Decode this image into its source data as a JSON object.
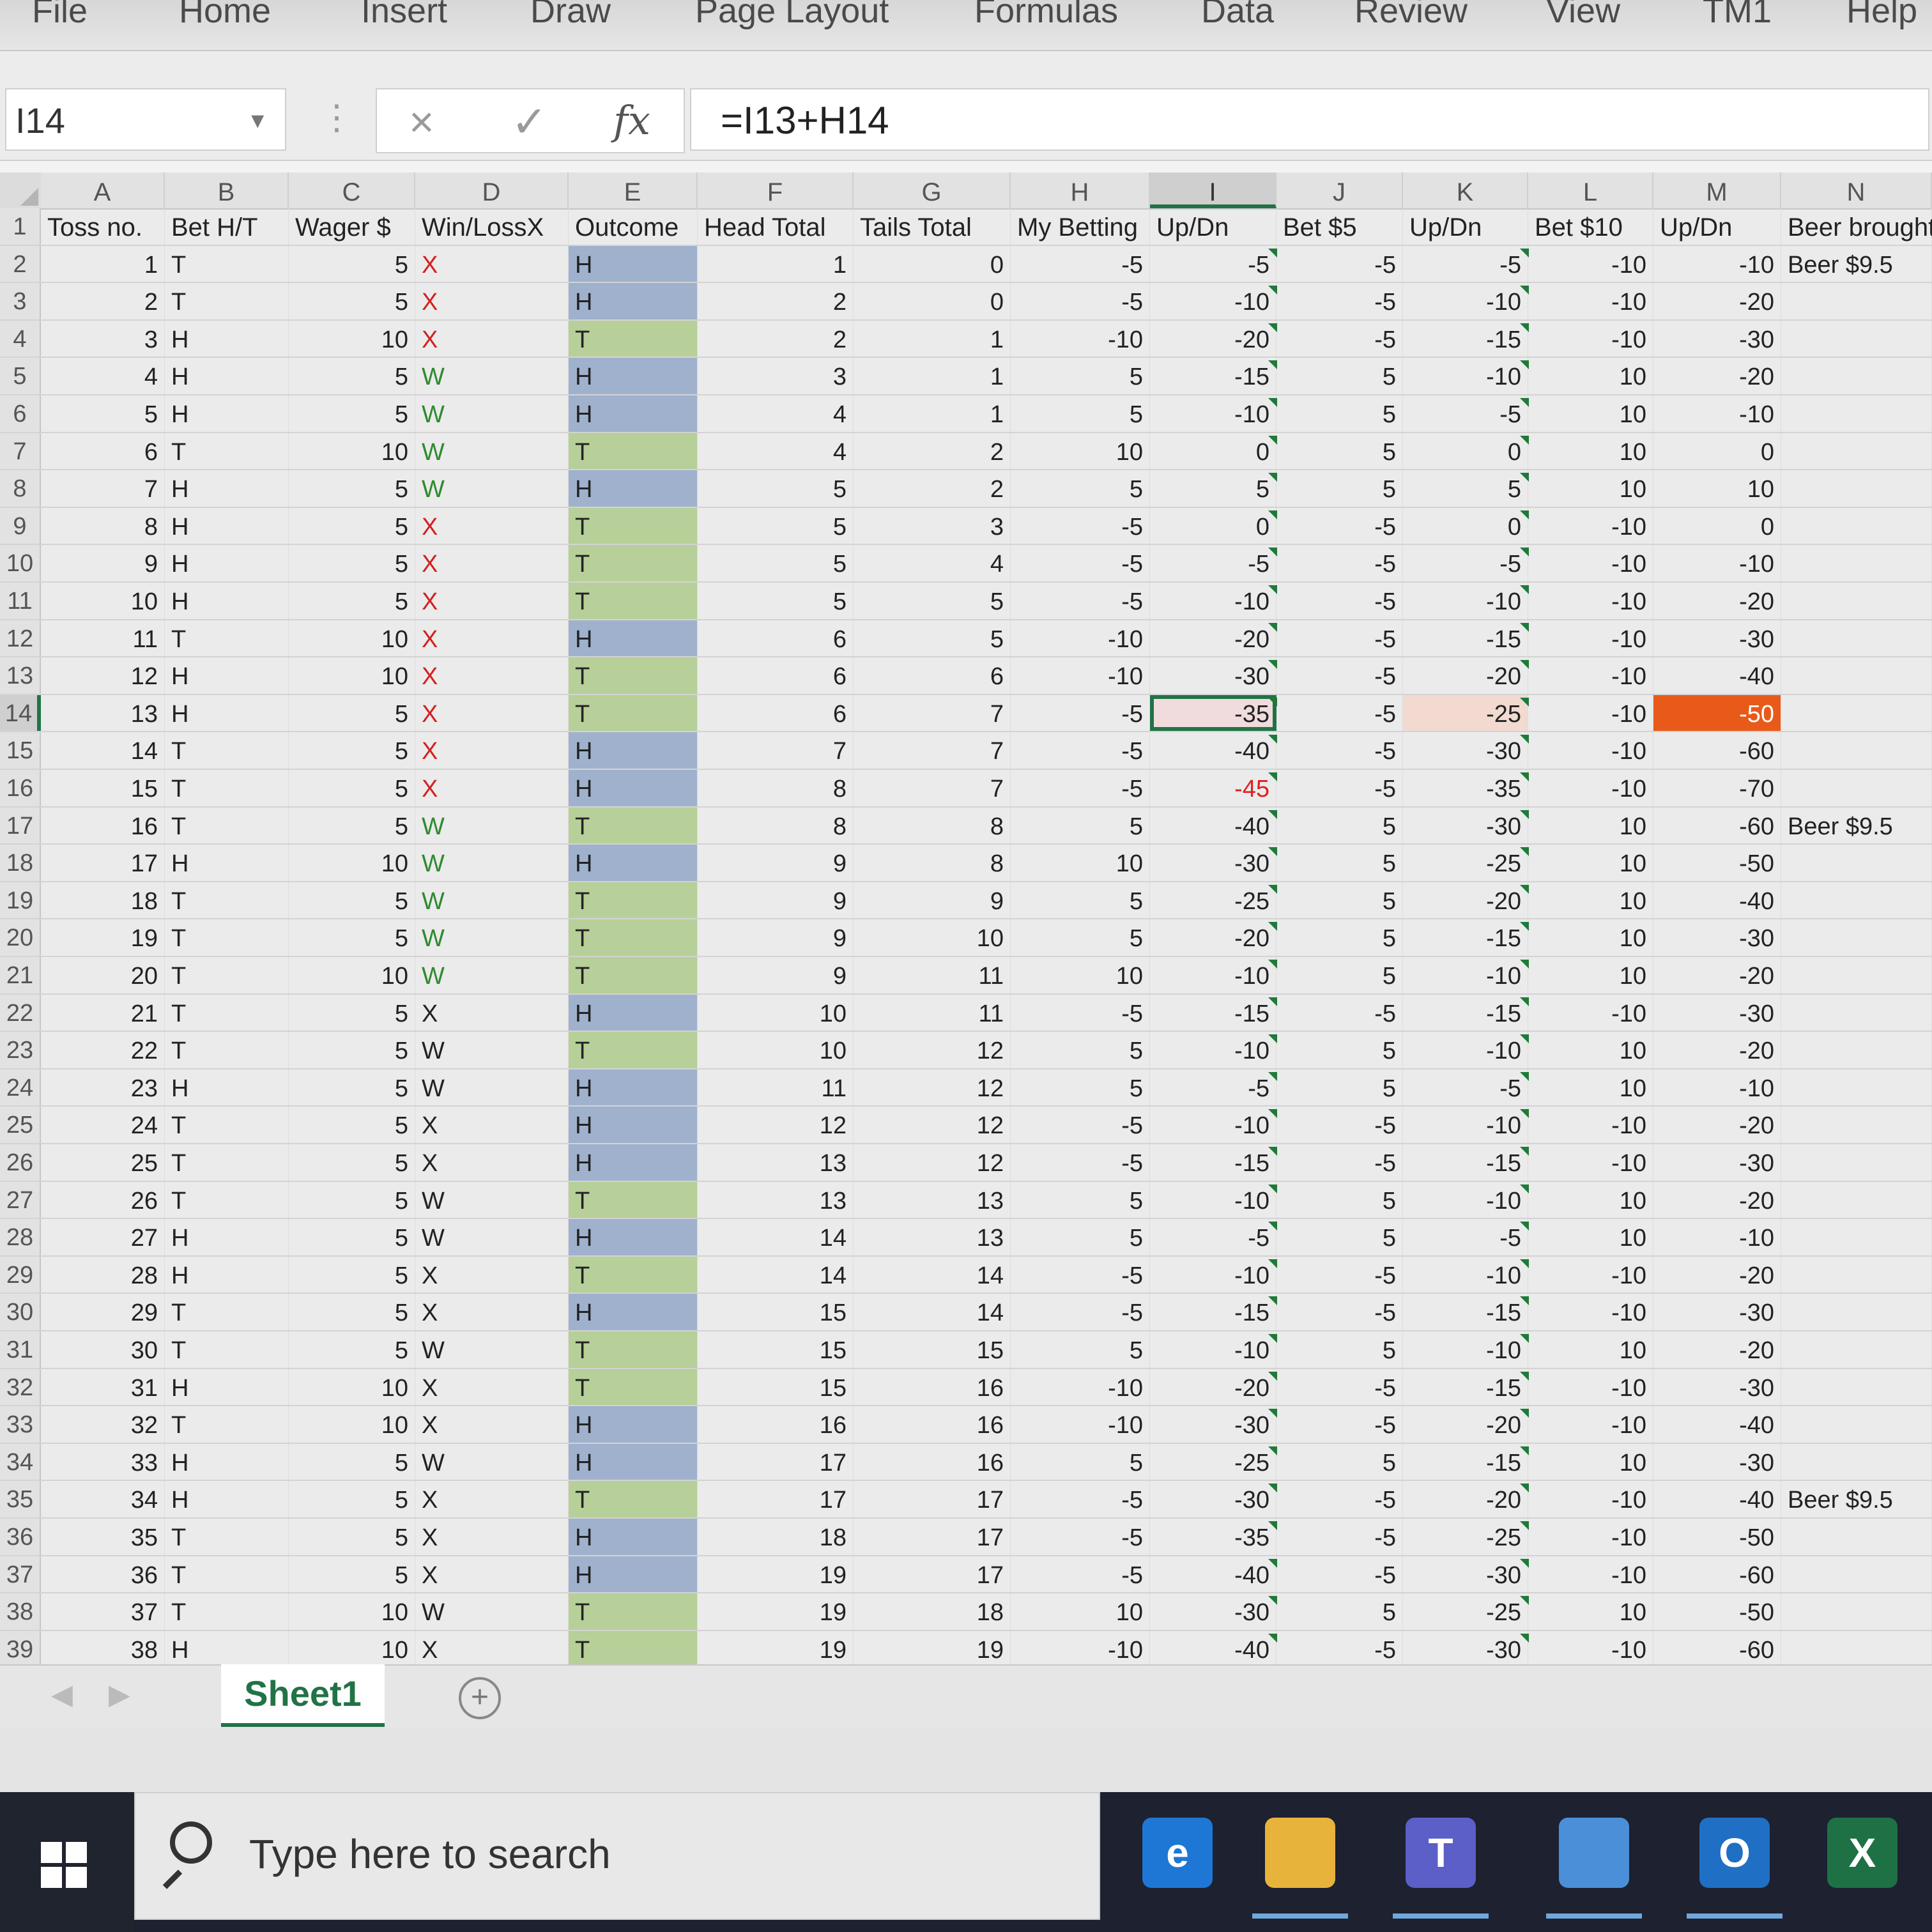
{
  "ribbon": {
    "tabs": [
      "File",
      "Home",
      "Insert",
      "Draw",
      "Page Layout",
      "Formulas",
      "Data",
      "Review",
      "View",
      "TM1",
      "Help"
    ]
  },
  "formula_bar": {
    "name_box": "I14",
    "cancel_icon": "×",
    "enter_icon": "✓",
    "fx_label": "fx",
    "formula": "=I13+H14"
  },
  "columns": [
    "A",
    "B",
    "C",
    "D",
    "E",
    "F",
    "G",
    "H",
    "I",
    "J",
    "K",
    "L",
    "M",
    "N"
  ],
  "header_row": {
    "row_num": "1",
    "cells": [
      "Toss no.",
      "Bet H/T",
      "Wager $",
      "Win/LossX",
      "Outcome",
      "Head Total",
      "Tails Total",
      "My Betting",
      "Up/Dn",
      "Bet $5",
      "Up/Dn",
      "Bet $10",
      "Up/Dn",
      "Beer brought"
    ]
  },
  "rows": [
    [
      "2",
      "1",
      "T",
      "5",
      "X",
      "H",
      "1",
      "0",
      "-5",
      "-5",
      "-5",
      "-5",
      "-10",
      "-10",
      "Beer $9.5"
    ],
    [
      "3",
      "2",
      "T",
      "5",
      "X",
      "H",
      "2",
      "0",
      "-5",
      "-10",
      "-5",
      "-10",
      "-10",
      "-20",
      ""
    ],
    [
      "4",
      "3",
      "H",
      "10",
      "X",
      "T",
      "2",
      "1",
      "-10",
      "-20",
      "-5",
      "-15",
      "-10",
      "-30",
      ""
    ],
    [
      "5",
      "4",
      "H",
      "5",
      "W",
      "H",
      "3",
      "1",
      "5",
      "-15",
      "5",
      "-10",
      "10",
      "-20",
      ""
    ],
    [
      "6",
      "5",
      "H",
      "5",
      "W",
      "H",
      "4",
      "1",
      "5",
      "-10",
      "5",
      "-5",
      "10",
      "-10",
      ""
    ],
    [
      "7",
      "6",
      "T",
      "10",
      "W",
      "T",
      "4",
      "2",
      "10",
      "0",
      "5",
      "0",
      "10",
      "0",
      ""
    ],
    [
      "8",
      "7",
      "H",
      "5",
      "W",
      "H",
      "5",
      "2",
      "5",
      "5",
      "5",
      "5",
      "10",
      "10",
      ""
    ],
    [
      "9",
      "8",
      "H",
      "5",
      "X",
      "T",
      "5",
      "3",
      "-5",
      "0",
      "-5",
      "0",
      "-10",
      "0",
      ""
    ],
    [
      "10",
      "9",
      "H",
      "5",
      "X",
      "T",
      "5",
      "4",
      "-5",
      "-5",
      "-5",
      "-5",
      "-10",
      "-10",
      ""
    ],
    [
      "11",
      "10",
      "H",
      "5",
      "X",
      "T",
      "5",
      "5",
      "-5",
      "-10",
      "-5",
      "-10",
      "-10",
      "-20",
      ""
    ],
    [
      "12",
      "11",
      "T",
      "10",
      "X",
      "H",
      "6",
      "5",
      "-10",
      "-20",
      "-5",
      "-15",
      "-10",
      "-30",
      ""
    ],
    [
      "13",
      "12",
      "H",
      "10",
      "X",
      "T",
      "6",
      "6",
      "-10",
      "-30",
      "-5",
      "-20",
      "-10",
      "-40",
      ""
    ],
    [
      "14",
      "13",
      "H",
      "5",
      "X",
      "T",
      "6",
      "7",
      "-5",
      "-35",
      "-5",
      "-25",
      "-10",
      "-50",
      ""
    ],
    [
      "15",
      "14",
      "T",
      "5",
      "X",
      "H",
      "7",
      "7",
      "-5",
      "-40",
      "-5",
      "-30",
      "-10",
      "-60",
      ""
    ],
    [
      "16",
      "15",
      "T",
      "5",
      "X",
      "H",
      "8",
      "7",
      "-5",
      "-45",
      "-5",
      "-35",
      "-10",
      "-70",
      ""
    ],
    [
      "17",
      "16",
      "T",
      "5",
      "W",
      "T",
      "8",
      "8",
      "5",
      "-40",
      "5",
      "-30",
      "10",
      "-60",
      "Beer $9.5"
    ],
    [
      "18",
      "17",
      "H",
      "10",
      "W",
      "H",
      "9",
      "8",
      "10",
      "-30",
      "5",
      "-25",
      "10",
      "-50",
      ""
    ],
    [
      "19",
      "18",
      "T",
      "5",
      "W",
      "T",
      "9",
      "9",
      "5",
      "-25",
      "5",
      "-20",
      "10",
      "-40",
      ""
    ],
    [
      "20",
      "19",
      "T",
      "5",
      "W",
      "T",
      "9",
      "10",
      "5",
      "-20",
      "5",
      "-15",
      "10",
      "-30",
      ""
    ],
    [
      "21",
      "20",
      "T",
      "10",
      "W",
      "T",
      "9",
      "11",
      "10",
      "-10",
      "5",
      "-10",
      "10",
      "-20",
      ""
    ],
    [
      "22",
      "21",
      "T",
      "5",
      "X",
      "H",
      "10",
      "11",
      "-5",
      "-15",
      "-5",
      "-15",
      "-10",
      "-30",
      ""
    ],
    [
      "23",
      "22",
      "T",
      "5",
      "W",
      "T",
      "10",
      "12",
      "5",
      "-10",
      "5",
      "-10",
      "10",
      "-20",
      ""
    ],
    [
      "24",
      "23",
      "H",
      "5",
      "W",
      "H",
      "11",
      "12",
      "5",
      "-5",
      "5",
      "-5",
      "10",
      "-10",
      ""
    ],
    [
      "25",
      "24",
      "T",
      "5",
      "X",
      "H",
      "12",
      "12",
      "-5",
      "-10",
      "-5",
      "-10",
      "-10",
      "-20",
      ""
    ],
    [
      "26",
      "25",
      "T",
      "5",
      "X",
      "H",
      "13",
      "12",
      "-5",
      "-15",
      "-5",
      "-15",
      "-10",
      "-30",
      ""
    ],
    [
      "27",
      "26",
      "T",
      "5",
      "W",
      "T",
      "13",
      "13",
      "5",
      "-10",
      "5",
      "-10",
      "10",
      "-20",
      ""
    ],
    [
      "28",
      "27",
      "H",
      "5",
      "W",
      "H",
      "14",
      "13",
      "5",
      "-5",
      "5",
      "-5",
      "10",
      "-10",
      ""
    ],
    [
      "29",
      "28",
      "H",
      "5",
      "X",
      "T",
      "14",
      "14",
      "-5",
      "-10",
      "-5",
      "-10",
      "-10",
      "-20",
      ""
    ],
    [
      "30",
      "29",
      "T",
      "5",
      "X",
      "H",
      "15",
      "14",
      "-5",
      "-15",
      "-5",
      "-15",
      "-10",
      "-30",
      ""
    ],
    [
      "31",
      "30",
      "T",
      "5",
      "W",
      "T",
      "15",
      "15",
      "5",
      "-10",
      "5",
      "-10",
      "10",
      "-20",
      ""
    ],
    [
      "32",
      "31",
      "H",
      "10",
      "X",
      "T",
      "15",
      "16",
      "-10",
      "-20",
      "-5",
      "-15",
      "-10",
      "-30",
      ""
    ],
    [
      "33",
      "32",
      "T",
      "10",
      "X",
      "H",
      "16",
      "16",
      "-10",
      "-30",
      "-5",
      "-20",
      "-10",
      "-40",
      ""
    ],
    [
      "34",
      "33",
      "H",
      "5",
      "W",
      "H",
      "17",
      "16",
      "5",
      "-25",
      "5",
      "-15",
      "10",
      "-30",
      ""
    ],
    [
      "35",
      "34",
      "H",
      "5",
      "X",
      "T",
      "17",
      "17",
      "-5",
      "-30",
      "-5",
      "-20",
      "-10",
      "-40",
      "Beer $9.5"
    ],
    [
      "36",
      "35",
      "T",
      "5",
      "X",
      "H",
      "18",
      "17",
      "-5",
      "-35",
      "-5",
      "-25",
      "-10",
      "-50",
      ""
    ],
    [
      "37",
      "36",
      "T",
      "5",
      "X",
      "H",
      "19",
      "17",
      "-5",
      "-40",
      "-5",
      "-30",
      "-10",
      "-60",
      ""
    ],
    [
      "38",
      "37",
      "T",
      "10",
      "W",
      "T",
      "19",
      "18",
      "10",
      "-30",
      "5",
      "-25",
      "10",
      "-50",
      ""
    ],
    [
      "39",
      "38",
      "H",
      "10",
      "X",
      "T",
      "19",
      "19",
      "-10",
      "-40",
      "-5",
      "-30",
      "-10",
      "-60",
      ""
    ]
  ],
  "selected_cell": {
    "row": "14",
    "col": "I"
  },
  "sheet_tabs": {
    "active": "Sheet1",
    "add_label": "+"
  },
  "taskbar": {
    "search_placeholder": "Type here to search",
    "apps": [
      {
        "name": "edge-icon",
        "label": "e",
        "color": "#1e77d4"
      },
      {
        "name": "file-explorer-icon",
        "label": "",
        "color": "#e8b33b"
      },
      {
        "name": "teams-icon",
        "label": "T",
        "color": "#5b5fc7"
      },
      {
        "name": "photos-icon",
        "label": "",
        "color": "#4a8fd8"
      },
      {
        "name": "outlook-icon",
        "label": "O",
        "color": "#1f6fc4"
      },
      {
        "name": "excel-icon",
        "label": "X",
        "color": "#1e7145"
      }
    ]
  },
  "colors": {
    "accent": "#217346",
    "outcome_heads": "#9fb1cc",
    "outcome_tails": "#b7cf98",
    "highlight_orange": "#e85a1a"
  }
}
